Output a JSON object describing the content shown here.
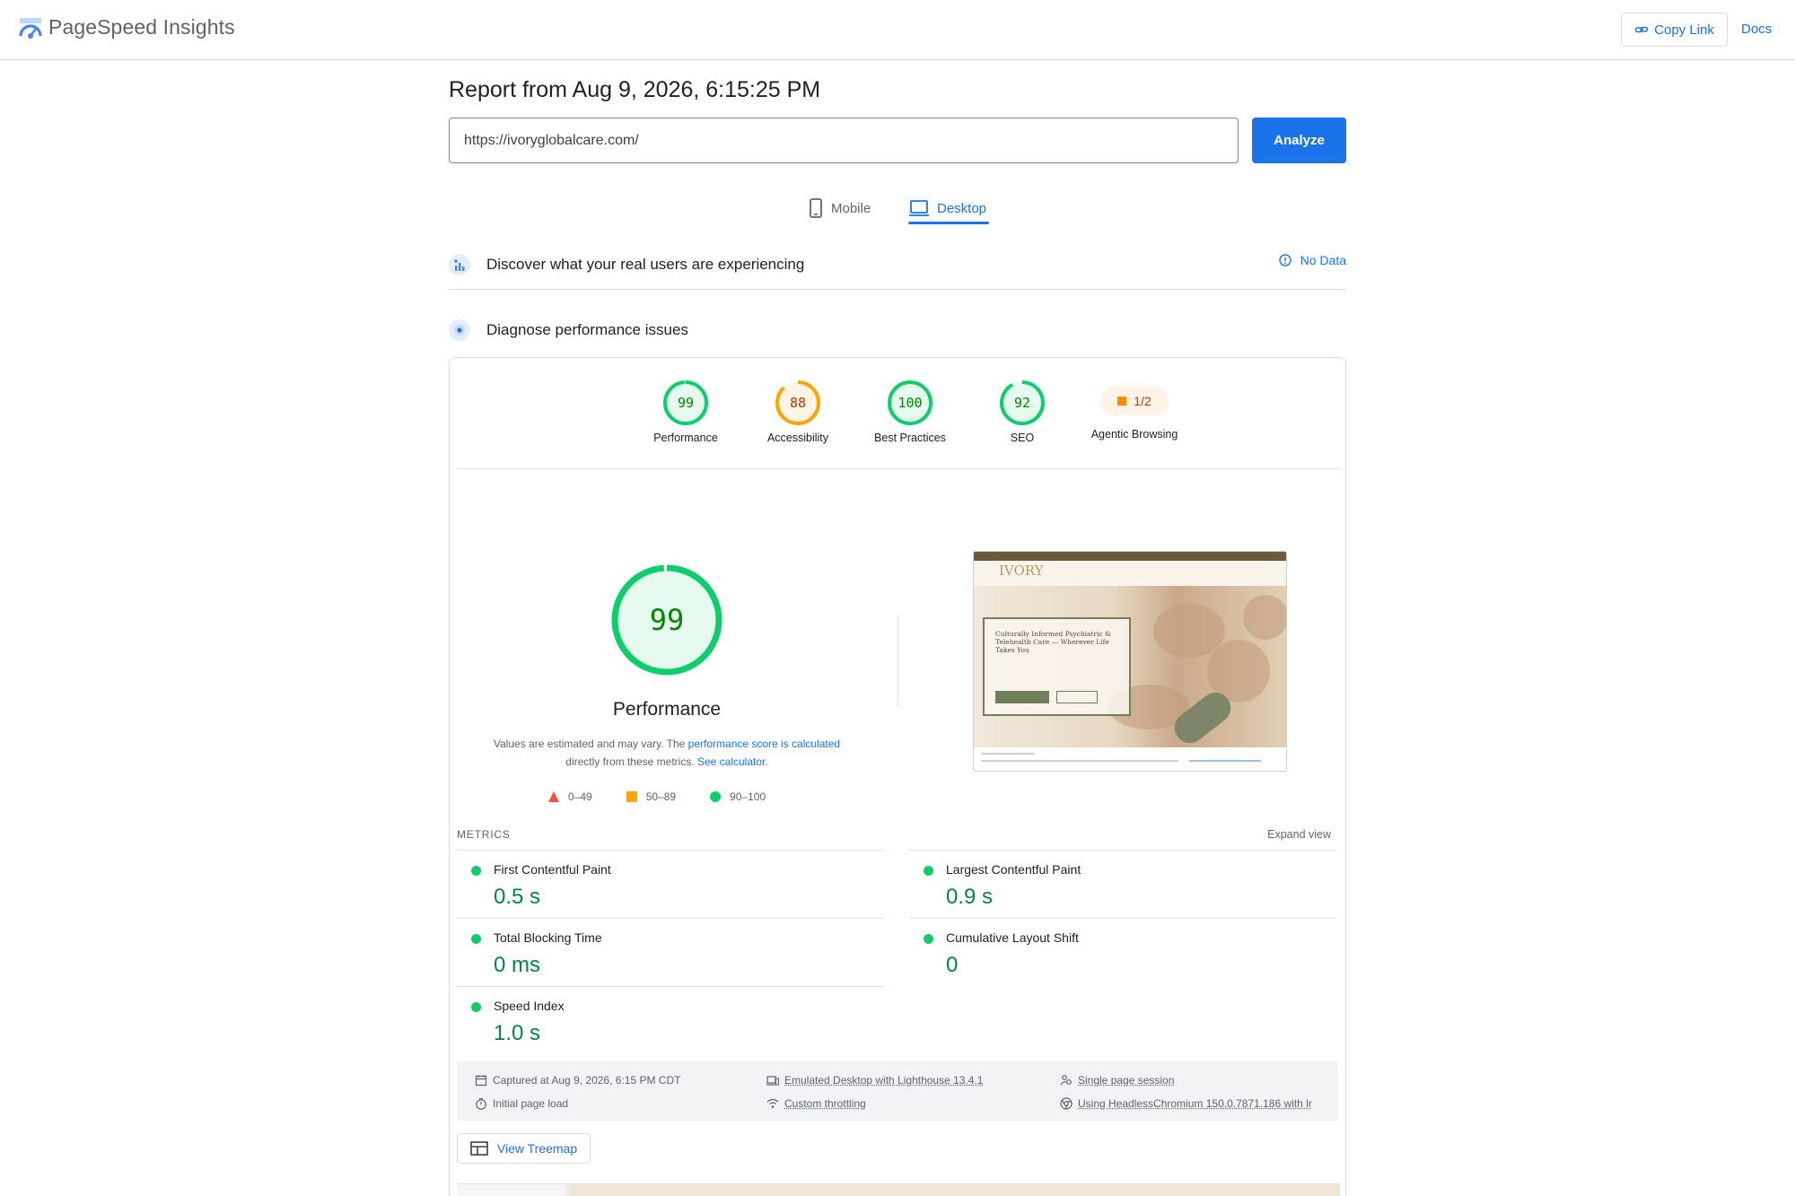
{
  "app": {
    "title": "PageSpeed Insights",
    "logo_icon": "pagespeed-logo-icon"
  },
  "topbar": {
    "copy_link_label": "Copy Link",
    "docs_label": "Docs"
  },
  "report": {
    "title": "Report from Aug 9, 2026, 6:15:25 PM",
    "url_value": "https://ivoryglobalcare.com/",
    "analyze_label": "Analyze"
  },
  "tabs": {
    "mobile": "Mobile",
    "desktop": "Desktop",
    "active": "Desktop"
  },
  "sections": {
    "discover_title": "Discover what your real users are experiencing",
    "no_data_label": "No Data",
    "diagnose_title": "Diagnose performance issues"
  },
  "categories": [
    {
      "label": "Performance",
      "score": 99,
      "color": "#0cce6b",
      "text_color": "#008800"
    },
    {
      "label": "Accessibility",
      "score": 88,
      "color": "#ffa400",
      "text_color": "#c33300"
    },
    {
      "label": "Best Practices",
      "score": 100,
      "color": "#0cce6b",
      "text_color": "#008800"
    },
    {
      "label": "SEO",
      "score": 92,
      "color": "#0cce6b",
      "text_color": "#008800"
    },
    {
      "label": "Agentic Browsing",
      "value": "1/2",
      "color": "#fa8c00"
    }
  ],
  "performance": {
    "score": 99,
    "title": "Performance",
    "note_text_1": "Values are estimated and may vary. The ",
    "note_link_1": "performance score is calculated",
    "note_text_2": "directly from these metrics. ",
    "note_link_2": "See calculator.",
    "legend": {
      "fail": "0–49",
      "average": "50–89",
      "pass": "90–100"
    }
  },
  "thumbnail": {
    "logo_text": "IVORY",
    "hero_text": "Culturally Informed Psychiatric & Telehealth Care — Wherever Life Takes You"
  },
  "metrics": {
    "label": "METRICS",
    "expand_label": "Expand view",
    "items": [
      {
        "name": "First Contentful Paint",
        "value": "0.5 s"
      },
      {
        "name": "Largest Contentful Paint",
        "value": "0.9 s"
      },
      {
        "name": "Total Blocking Time",
        "value": "0 ms"
      },
      {
        "name": "Cumulative Layout Shift",
        "value": "0"
      },
      {
        "name": "Speed Index",
        "value": "1.0 s"
      }
    ]
  },
  "capture": {
    "captured_at": "Captured at Aug 9, 2026, 6:15 PM CDT",
    "initial_load": "Initial page load",
    "emulated": "Emulated Desktop with Lighthouse 13.4.1",
    "throttling": "Custom throttling",
    "session": "Single page session",
    "browser": "Using HeadlessChromium 150.0.7871.186 with lr"
  },
  "treemap_label": "View Treemap"
}
